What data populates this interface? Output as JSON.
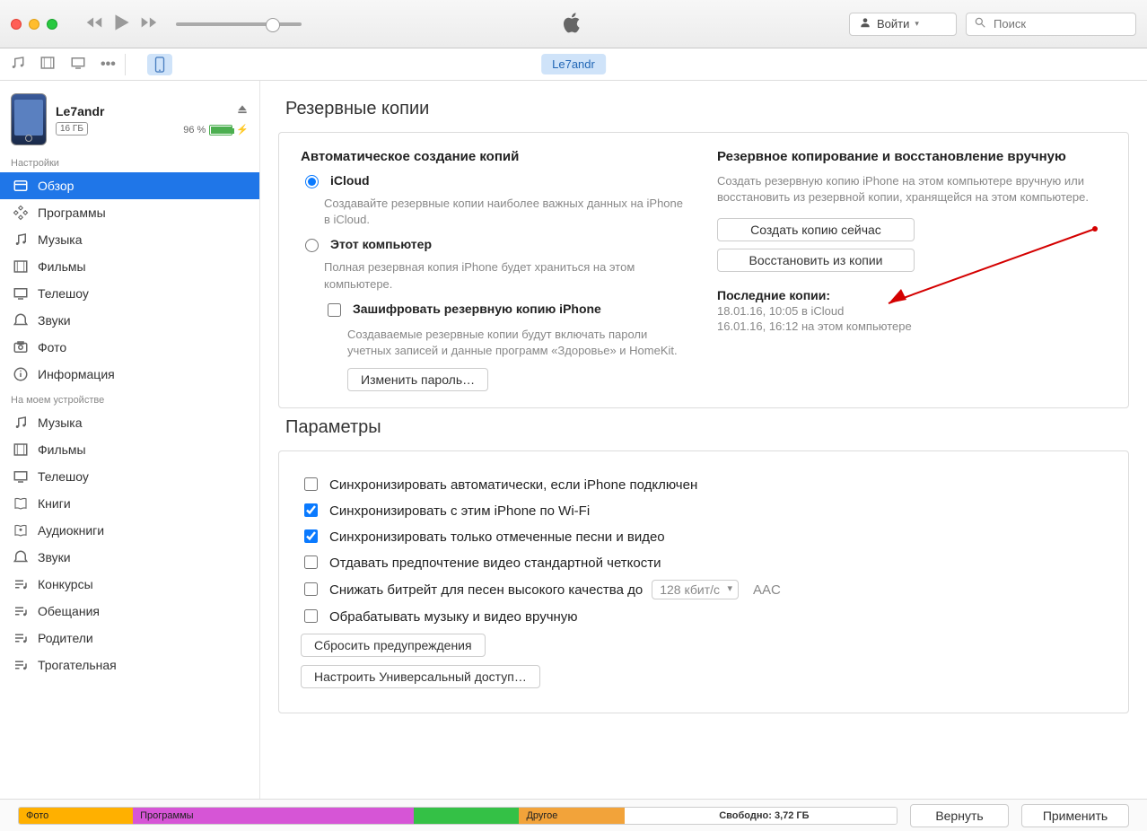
{
  "titlebar": {
    "login": "Войти",
    "search_placeholder": "Поиск"
  },
  "tabs": {
    "device_name": "Le7andr"
  },
  "device": {
    "name": "Le7andr",
    "capacity": "16 ГБ",
    "battery": "96 %"
  },
  "sidebar": {
    "settings_hdr": "Настройки",
    "settings": [
      {
        "label": "Обзор"
      },
      {
        "label": "Программы"
      },
      {
        "label": "Музыка"
      },
      {
        "label": "Фильмы"
      },
      {
        "label": "Телешоу"
      },
      {
        "label": "Звуки"
      },
      {
        "label": "Фото"
      },
      {
        "label": "Информация"
      }
    ],
    "ondevice_hdr": "На моем устройстве",
    "ondevice": [
      {
        "label": "Музыка"
      },
      {
        "label": "Фильмы"
      },
      {
        "label": "Телешоу"
      },
      {
        "label": "Книги"
      },
      {
        "label": "Аудиокниги"
      },
      {
        "label": "Звуки"
      },
      {
        "label": "Конкурсы"
      },
      {
        "label": "Обещания"
      },
      {
        "label": "Родители"
      },
      {
        "label": "Трогательная"
      }
    ]
  },
  "backups": {
    "title": "Резервные копии",
    "auto_title": "Автоматическое создание копий",
    "icloud": "iCloud",
    "icloud_desc": "Создавайте резервные копии наиболее важных данных на iPhone в iCloud.",
    "thispc": "Этот компьютер",
    "thispc_desc": "Полная резервная копия iPhone будет храниться на этом компьютере.",
    "encrypt": "Зашифровать резервную копию iPhone",
    "encrypt_desc": "Создаваемые резервные копии будут включать пароли учетных записей и данные программ «Здоровье» и HomeKit.",
    "change_pw": "Изменить пароль…",
    "manual_title": "Резервное копирование и восстановление вручную",
    "manual_desc": "Создать резервную копию iPhone на этом компьютере вручную или восстановить из резервной копии, хранящейся на этом компьютере.",
    "backup_now": "Создать копию сейчас",
    "restore": "Восстановить из копии",
    "last_title": "Последние копии:",
    "last1": "18.01.16, 10:05 в iCloud",
    "last2": "16.01.16, 16:12 на этом компьютере"
  },
  "params": {
    "title": "Параметры",
    "o1": "Синхронизировать автоматически, если iPhone подключен",
    "o2": "Синхронизировать с этим iPhone по Wi-Fi",
    "o3": "Синхронизировать только отмеченные песни и видео",
    "o4": "Отдавать предпочтение видео стандартной четкости",
    "o5": "Снижать битрейт для песен высокого качества до",
    "bitrate": "128 кбит/с",
    "aac": "AAC",
    "o6": "Обрабатывать музыку и видео вручную",
    "reset": "Сбросить предупреждения",
    "universal": "Настроить Универсальный доступ…"
  },
  "footer": {
    "photo": "Фото",
    "apps": "Программы",
    "other": "Другое",
    "free": "Свободно: 3,72 ГБ",
    "revert": "Вернуть",
    "apply": "Применить"
  }
}
